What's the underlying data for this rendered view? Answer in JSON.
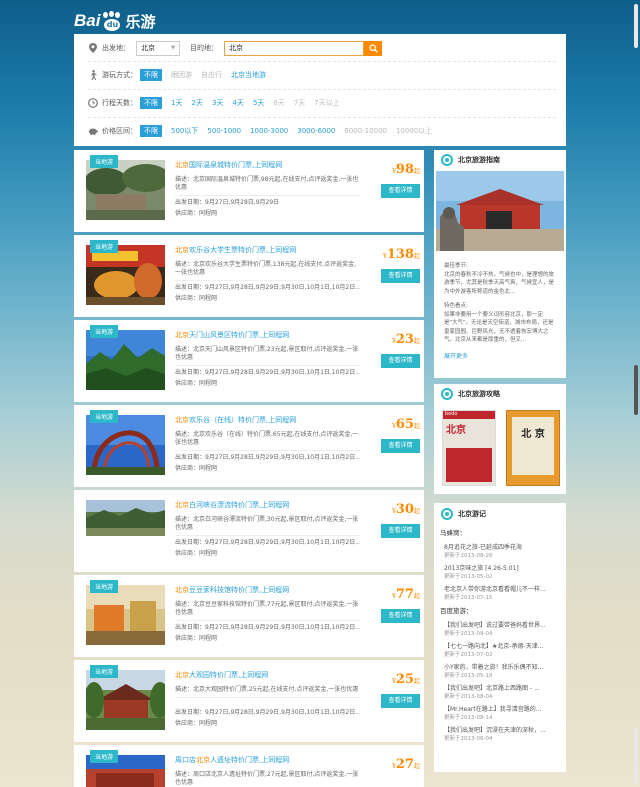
{
  "brand": {
    "name_prefix": "Bai",
    "name_paw": "du",
    "name_suffix": "乐游"
  },
  "filter": {
    "departure_label": "出发地：",
    "departure_value": "北京",
    "destination_label": "目的地：",
    "destination_value": "北京",
    "mode_label": "游玩方式：",
    "modes": [
      "不限",
      "跟团游",
      "自由行",
      "北京当地游"
    ],
    "days_label": "行程天数：",
    "days": [
      "不限",
      "1天",
      "2天",
      "3天",
      "4天",
      "5天",
      "6天",
      "7天",
      "7天以上"
    ],
    "price_label": "价格区间：",
    "prices": [
      "不限",
      "500以下",
      "500-1000",
      "1000-3000",
      "3000-6000",
      "6000-10000",
      "10000以上"
    ]
  },
  "card_common": {
    "tag": "当地游",
    "detail_button": "查看详情",
    "yen": "¥",
    "qi": "起"
  },
  "products": [
    {
      "hl": "北京",
      "title": "国际温泉城特价门票,上同程网",
      "desc": "描述：北京国际温泉城特价门票,98元起,在线支付,点评返奖金,一张也优惠",
      "date": "出发日期：9月27日,9月28日,9月29日",
      "provider": "供应商：同程网",
      "price": "98"
    },
    {
      "hl": "北京",
      "title": "欢乐谷大学生票特价门票,上同程网",
      "desc": "描述：北京欢乐谷大学生票特价门票,138元起,在线支付,点评返奖金,一张也优惠",
      "date": "出发日期：9月27日,9月28日,9月29日,9月30日,10月1日,10月2日...",
      "provider": "供应商：同程网",
      "price": "138"
    },
    {
      "hl": "北京",
      "title": "天门山风景区特价门票,上同程网",
      "desc": "描述：北京天门山风景区特价门票,23元起,景区取付,点评返奖金,一张也优惠",
      "date": "出发日期：9月27日,9月28日,9月29日,9月30日,10月1日,10月2日...",
      "provider": "供应商：同程网",
      "price": "23"
    },
    {
      "hl": "北京",
      "title": "欢乐谷（在线）特价门票,上同程网",
      "desc": "描述：北京欢乐谷（在线）特价门票,65元起,在线支付,点评返奖金,一张也优惠",
      "date": "出发日期：9月27日,9月28日,9月29日,9月30日,10月1日,10月2日...",
      "provider": "供应商：同程网",
      "price": "65"
    },
    {
      "hl": "北京",
      "title": "白河峡谷漂流特价门票,上同程网",
      "desc": "描述：北京白河峡谷漂流特价门票,30元起,景区取付,点评返奖金,一张也优惠",
      "date": "出发日期：9月27日,9月28日,9月29日,9月30日,10月1日,10月2日...",
      "provider": "供应商：同程网",
      "price": "30"
    },
    {
      "hl": "北京",
      "title": "豆豆家科技馆特价门票,上同程网",
      "desc": "描述：北京豆豆家科技馆特价门票,77元起,景区取付,点评返奖金,一张也优惠",
      "date": "出发日期：9月27日,9月28日,9月29日,9月30日,10月1日,10月2日...",
      "provider": "供应商：同程网",
      "price": "77"
    },
    {
      "hl": "北京",
      "title": "大观园特价门票,上同程网",
      "desc": "描述：北京大观园特价门票,25元起,在线支付,点评返奖金,一张也优惠",
      "date": "出发日期：9月27日,9月28日,9月29日,9月30日,10月1日,10月2日...",
      "provider": "供应商：同程网",
      "price": "25"
    },
    {
      "pre": "周口店",
      "hl": "北京",
      "title": "人遗址特价门票,上同程网",
      "desc": "描述：周口店北京人遗址特价门票,27元起,景区取付,点评返奖金,一张也优惠",
      "date": "",
      "provider": "",
      "price": "27"
    }
  ],
  "guide": {
    "title": "北京旅游指南",
    "season_label": "最佳季节:",
    "season_text": "北京的春秋不冷不热，气候也中，是理想的旅游季节，尤其是秋季天高气爽，气候宜人，是为中外游客所称道的金色北...",
    "feature_label": "特色看点:",
    "feature_text": "如果非要用一个要义词形容北京，那一定是\"大气\"。无论是天空街道、城市布局，还是皇家园囿、巨野风光，无不透着恢宏博大之气。北京从来都是厚重的，但又...",
    "more": "展开更多"
  },
  "strategy": {
    "title": "北京旅游攻略",
    "book1_brand": "bedo",
    "book1_title": "北京",
    "book2_title": "北 京"
  },
  "notes": {
    "title": "北京游记",
    "mafengwo_label": "马蜂窝：",
    "mafengwo": [
      {
        "t": "8月追花之旅-已延成四季花海",
        "d": "更新于2013-08-26"
      },
      {
        "t": "2013京味之旅 [4.26-5.01]",
        "d": "更新于2013-05-02"
      },
      {
        "t": "老北京人带你游北京看看帽儿不一样...",
        "d": "更新于2013-07-15"
      }
    ],
    "baidu_label": "百度旅游：",
    "baidu": [
      {
        "t": "【我们出发吧】说过要带爸妈看世界...",
        "d": "更新于2013-09-04"
      },
      {
        "t": "【七七一路向北】★北京-承德-天津...",
        "d": "更新于2013-07-02"
      },
      {
        "t": "小Y家的，带着之旅！我乐乐偶不知...",
        "d": "更新于2013-05-18"
      },
      {
        "t": "【我们出发吧】北京路上西路图 - ...",
        "d": "更新于2013-08-04"
      },
      {
        "t": "【Mr.Heart在路上】我寻清宫路的...",
        "d": "更新于2013-08-14"
      },
      {
        "t": "【我们出发吧】沉浸在天津的深秋，...",
        "d": "更新于2013-06-04"
      }
    ]
  }
}
